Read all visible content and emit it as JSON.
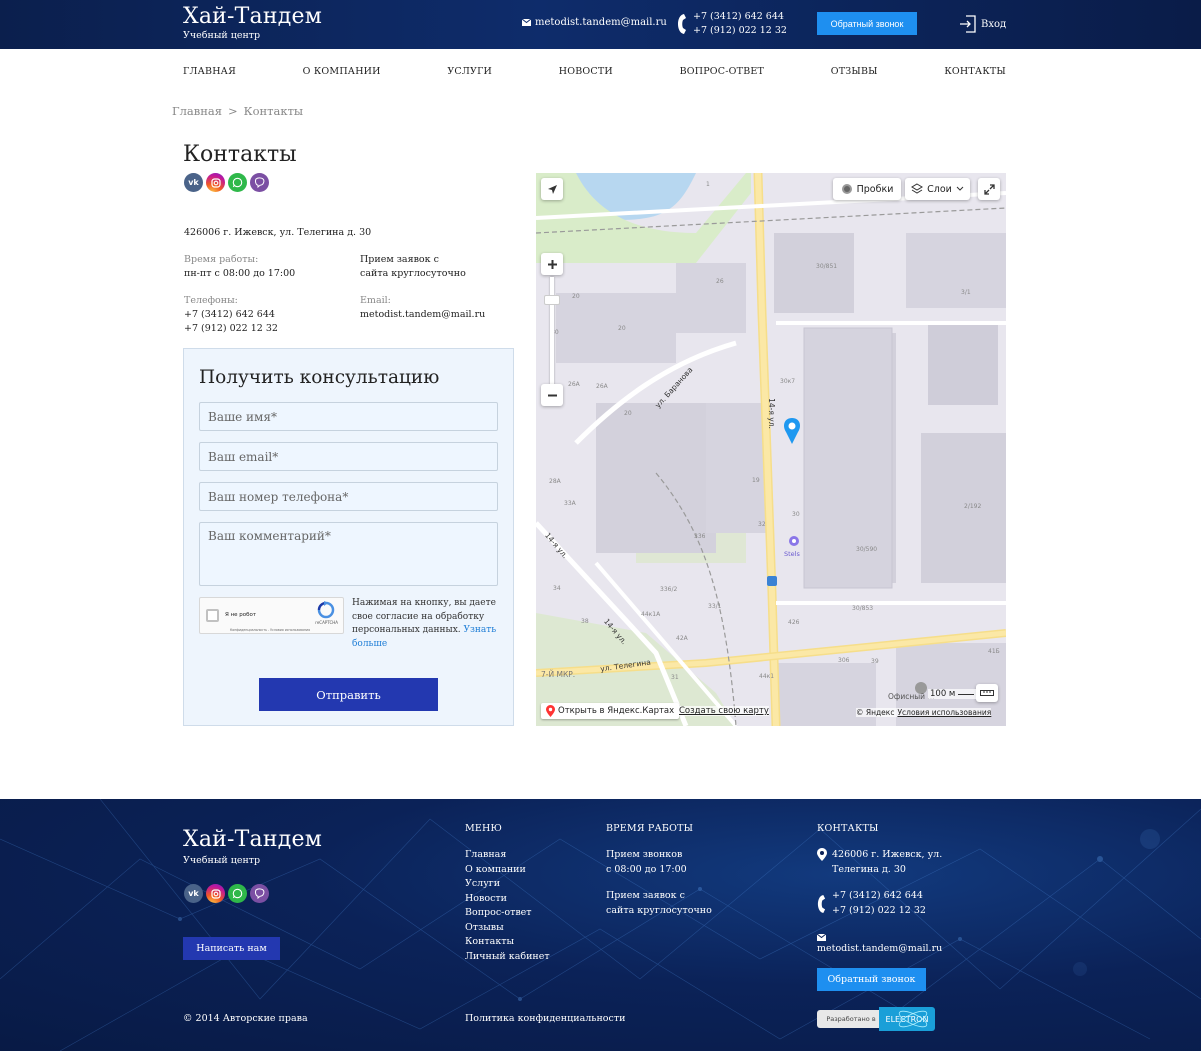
{
  "header": {
    "logo_title": "Хай-Тандем",
    "logo_subtitle": "Учебный центр",
    "email": "metodist.tandem@mail.ru",
    "phones": [
      "+7 (3412) 642 644",
      "+7 (912) 022 12 32"
    ],
    "callback_label": "Обратный звонок",
    "login_label": "Вход"
  },
  "nav": [
    "ГЛАВНАЯ",
    "О КОМПАНИИ",
    "УСЛУГИ",
    "НОВОСТИ",
    "ВОПРОС-ОТВЕТ",
    "ОТЗЫВЫ",
    "КОНТАКТЫ"
  ],
  "breadcrumb": {
    "home": "Главная",
    "sep": ">",
    "current": "Контакты"
  },
  "page_title": "Контакты",
  "socials": [
    "vk-icon",
    "instagram-icon",
    "whatsapp-icon",
    "viber-icon"
  ],
  "contacts": {
    "address": "426006 г. Ижевск, ул. Телегина д. 30",
    "hours_label": "Время работы:",
    "hours_value": "пн-пт с 08:00 до 17:00",
    "requests_line1": "Прием заявок с",
    "requests_line2": "сайта круглосуточно",
    "phones_label": "Телефоны:",
    "phone1": "+7 (3412) 642 644",
    "phone2": "+7 (912) 022 12 32",
    "email_label": "Email:",
    "email_value": "metodist.tandem@mail.ru"
  },
  "form": {
    "title": "Получить консультацию",
    "name_placeholder": "Ваше имя*",
    "email_placeholder": "Ваш email*",
    "phone_placeholder": "Ваш номер телефона*",
    "comment_placeholder": "Ваш комментарий*",
    "captcha_label": "Я не робот",
    "captcha_brand": "reCAPTCHA",
    "captcha_links": "Конфиденциальность - Условия использования",
    "consent_text": "Нажимая на кнопку, вы даете свое согласие на обработку персональных данных.",
    "consent_link": "Узнать больше",
    "submit_label": "Отправить"
  },
  "map": {
    "traffic_label": "Пробки",
    "layers_label": "Слои",
    "open_label": "Открыть в Яндекс.Картах",
    "create_label": "Создать свою карту",
    "copyright": "© Яндекс",
    "terms": "Условия использования",
    "scale": "100 м",
    "poi_label": "Офисный ...",
    "streets": [
      "ул. Баранова",
      "14-я ул.",
      "14-я ул.",
      "14-я ул.",
      "ул. Телегина",
      "7-Й МКР."
    ],
    "poi": "Stels",
    "buildings": [
      "1",
      "26",
      "20",
      "20",
      "30/851",
      "3/1",
      "30",
      "26А",
      "26А",
      "20",
      "30к7",
      "28А",
      "33А",
      "19",
      "30",
      "2/192",
      "32",
      "336",
      "30/590",
      "34",
      "336/2",
      "33/1",
      "30/853",
      "38",
      "44к1А",
      "42А",
      "426",
      "306",
      "39",
      "41Б",
      "31",
      "44к1",
      "49/1"
    ]
  },
  "footer": {
    "logo_title": "Хай-Тандем",
    "logo_subtitle": "Учебный центр",
    "write_label": "Написать нам",
    "copyright": "© 2014 Авторские права",
    "menu_title": "МЕНЮ",
    "menu": [
      "Главная",
      "О компании",
      "Услуги",
      "Новости",
      "Вопрос-ответ",
      "Отзывы",
      "Контакты",
      "Личный кабинет"
    ],
    "privacy": "Политика конфиденциальности",
    "hours_title": "ВРЕМЯ РАБОТЫ",
    "hours_line1": "Прием звонков",
    "hours_line2": "с 08:00 до 17:00",
    "requests_line1": "Прием заявок с",
    "requests_line2": "сайта круглосуточно",
    "contacts_title": "КОНТАКТЫ",
    "address_line1": "426006 г. Ижевск, ул.",
    "address_line2": "Телегина д. 30",
    "phone1": "+7 (3412) 642 644",
    "phone2": "+7 (912) 022 12 32",
    "email": "metodist.tandem@mail.ru",
    "callback_label": "Обратный звонок",
    "dev_prefix": "Разработано в",
    "dev_brand": "ELECTRON"
  }
}
